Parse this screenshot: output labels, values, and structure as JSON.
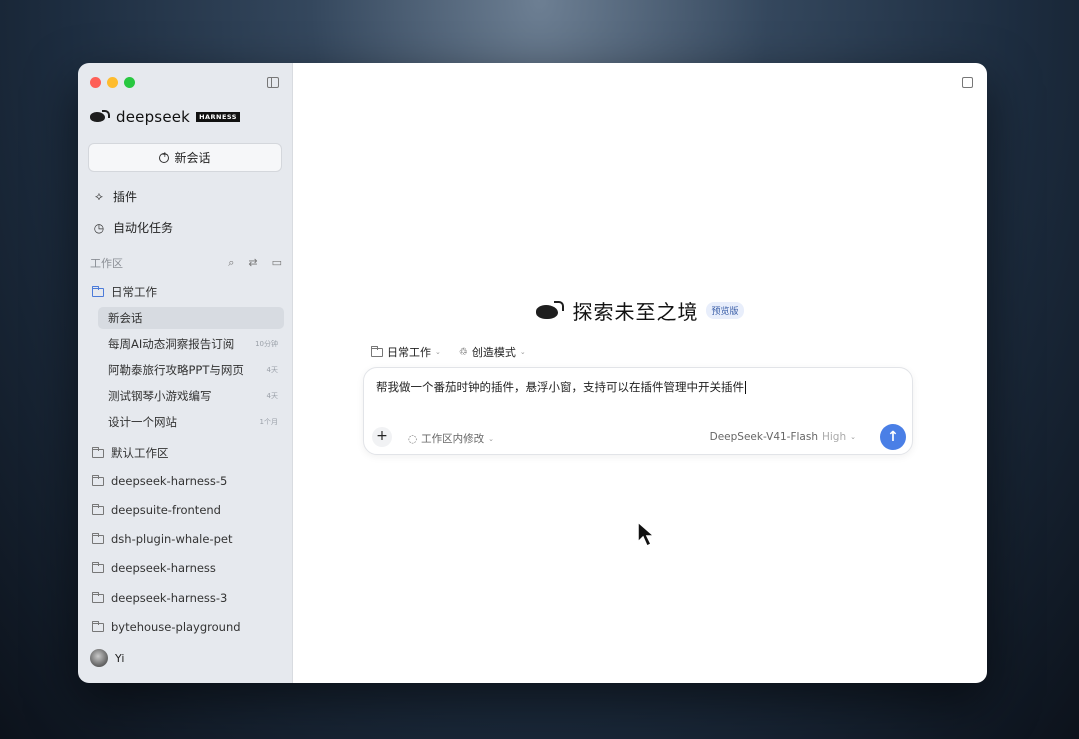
{
  "brand": {
    "name": "deepseek",
    "badge": "HARNESS"
  },
  "sidebar": {
    "new_chat_label": "新会话",
    "nav": [
      {
        "label": "插件",
        "icon": "puzzle-icon"
      },
      {
        "label": "自动化任务",
        "icon": "clock-icon"
      }
    ],
    "workspace_heading": "工作区",
    "workspaces": [
      {
        "name": "日常工作",
        "expanded": true,
        "chats": [
          {
            "title": "新会话",
            "time": "",
            "active": true
          },
          {
            "title": "每周AI动态洞察报告订阅",
            "time": "10分钟"
          },
          {
            "title": "阿勒泰旅行攻略PPT与网页",
            "time": "4天"
          },
          {
            "title": "测试钢琴小游戏编写",
            "time": "4天"
          },
          {
            "title": "设计一个网站",
            "time": "1个月"
          }
        ]
      },
      {
        "name": "默认工作区"
      },
      {
        "name": "deepseek-harness-5"
      },
      {
        "name": "deepsuite-frontend"
      },
      {
        "name": "dsh-plugin-whale-pet"
      },
      {
        "name": "deepseek-harness"
      },
      {
        "name": "deepseek-harness-3"
      },
      {
        "name": "bytehouse-playground"
      }
    ],
    "user_name": "Yi"
  },
  "main": {
    "hero_title": "探索未至之境",
    "preview_badge": "预览版",
    "context_workspace": "日常工作",
    "context_mode": "创造模式",
    "prompt_text": "帮我做一个番茄时钟的插件，悬浮小窗，支持可以在插件管理中开关插件",
    "scope_mode": "工作区内修改",
    "model_name": "DeepSeek-V41-Flash",
    "model_level": "High"
  }
}
